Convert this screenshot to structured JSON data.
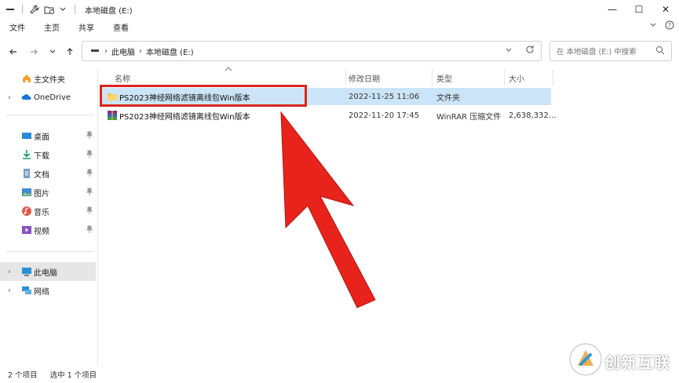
{
  "window": {
    "title": "本地磁盘 (E:)",
    "controls": [
      "—",
      "☐",
      "✕"
    ]
  },
  "ribbon": {
    "tabs": [
      "文件",
      "主页",
      "共享",
      "查看"
    ]
  },
  "address": {
    "crumbs": [
      "此电脑",
      "本地磁盘 (E:)"
    ]
  },
  "search": {
    "placeholder": "在 本地磁盘 (E:) 中搜索"
  },
  "sidebar": {
    "items": [
      {
        "label": "主文件夹",
        "icon": "home-icon"
      },
      {
        "label": "OneDrive",
        "icon": "cloud-icon"
      },
      {
        "label": "桌面",
        "icon": "desktop-icon"
      },
      {
        "label": "下载",
        "icon": "download-icon"
      },
      {
        "label": "文档",
        "icon": "document-icon"
      },
      {
        "label": "图片",
        "icon": "pictures-icon"
      },
      {
        "label": "音乐",
        "icon": "music-icon"
      },
      {
        "label": "视频",
        "icon": "video-icon"
      },
      {
        "label": "此电脑",
        "icon": "computer-icon"
      },
      {
        "label": "网络",
        "icon": "network-icon"
      }
    ]
  },
  "columns": {
    "name": "名称",
    "modified": "修改日期",
    "type": "类型",
    "size": "大小"
  },
  "files": [
    {
      "name": "PS2023神经网络滤镜离线包Win版本",
      "modified": "2022-11-25 11:06",
      "type": "文件夹",
      "size": "",
      "icon": "folder-icon",
      "selected": true
    },
    {
      "name": "PS2023神经网络滤镜离线包Win版本",
      "modified": "2022-11-20 17:45",
      "type": "WinRAR 压缩文件",
      "size": "2,638,332...",
      "icon": "winrar-icon",
      "selected": false
    }
  ],
  "status": {
    "count": "2 个项目",
    "selection": "选中 1 个项目"
  },
  "watermark": {
    "text": "创新互联"
  },
  "colors": {
    "selection": "#cce4f7",
    "highlight": "#d9261c",
    "arrow": "#e8231b"
  }
}
